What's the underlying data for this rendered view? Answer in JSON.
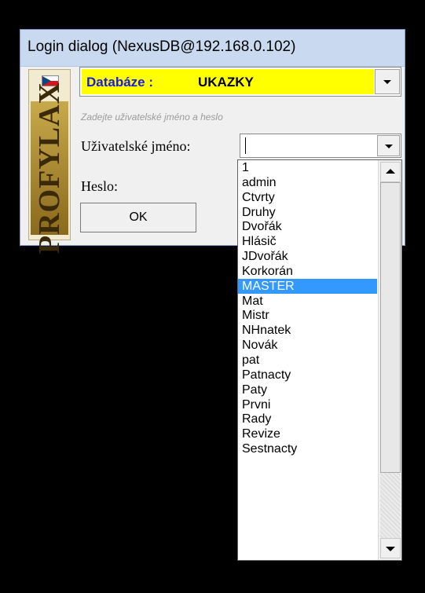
{
  "window": {
    "title": "Login dialog  (NexusDB@192.168.0.102)"
  },
  "logo": {
    "text": "PROFYLAX",
    "flag": "czech-flag"
  },
  "database": {
    "label": "Databáze :",
    "value": "UKAZKY"
  },
  "hint": "Zadejte uživatelské jméno a heslo",
  "username": {
    "label": "Uživatelské jméno:",
    "value": ""
  },
  "password": {
    "label": "Heslo:"
  },
  "ok_label": "OK",
  "dropdown": {
    "items": [
      "1",
      "admin",
      "Ctvrty",
      "Druhy",
      "Dvořák",
      "Hlásič",
      "JDvořák",
      "Korkorán",
      "MASTER",
      "Mat",
      "Mistr",
      "NHnatek",
      "Novák",
      "pat",
      "Patnacty",
      "Paty",
      "Prvni",
      "Rady",
      "Revize",
      "Sestnacty"
    ],
    "selected": "MASTER"
  },
  "colors": {
    "db_field_bg": "#ffff00",
    "selection": "#3399ff",
    "titlebar": "#c9daf0"
  }
}
